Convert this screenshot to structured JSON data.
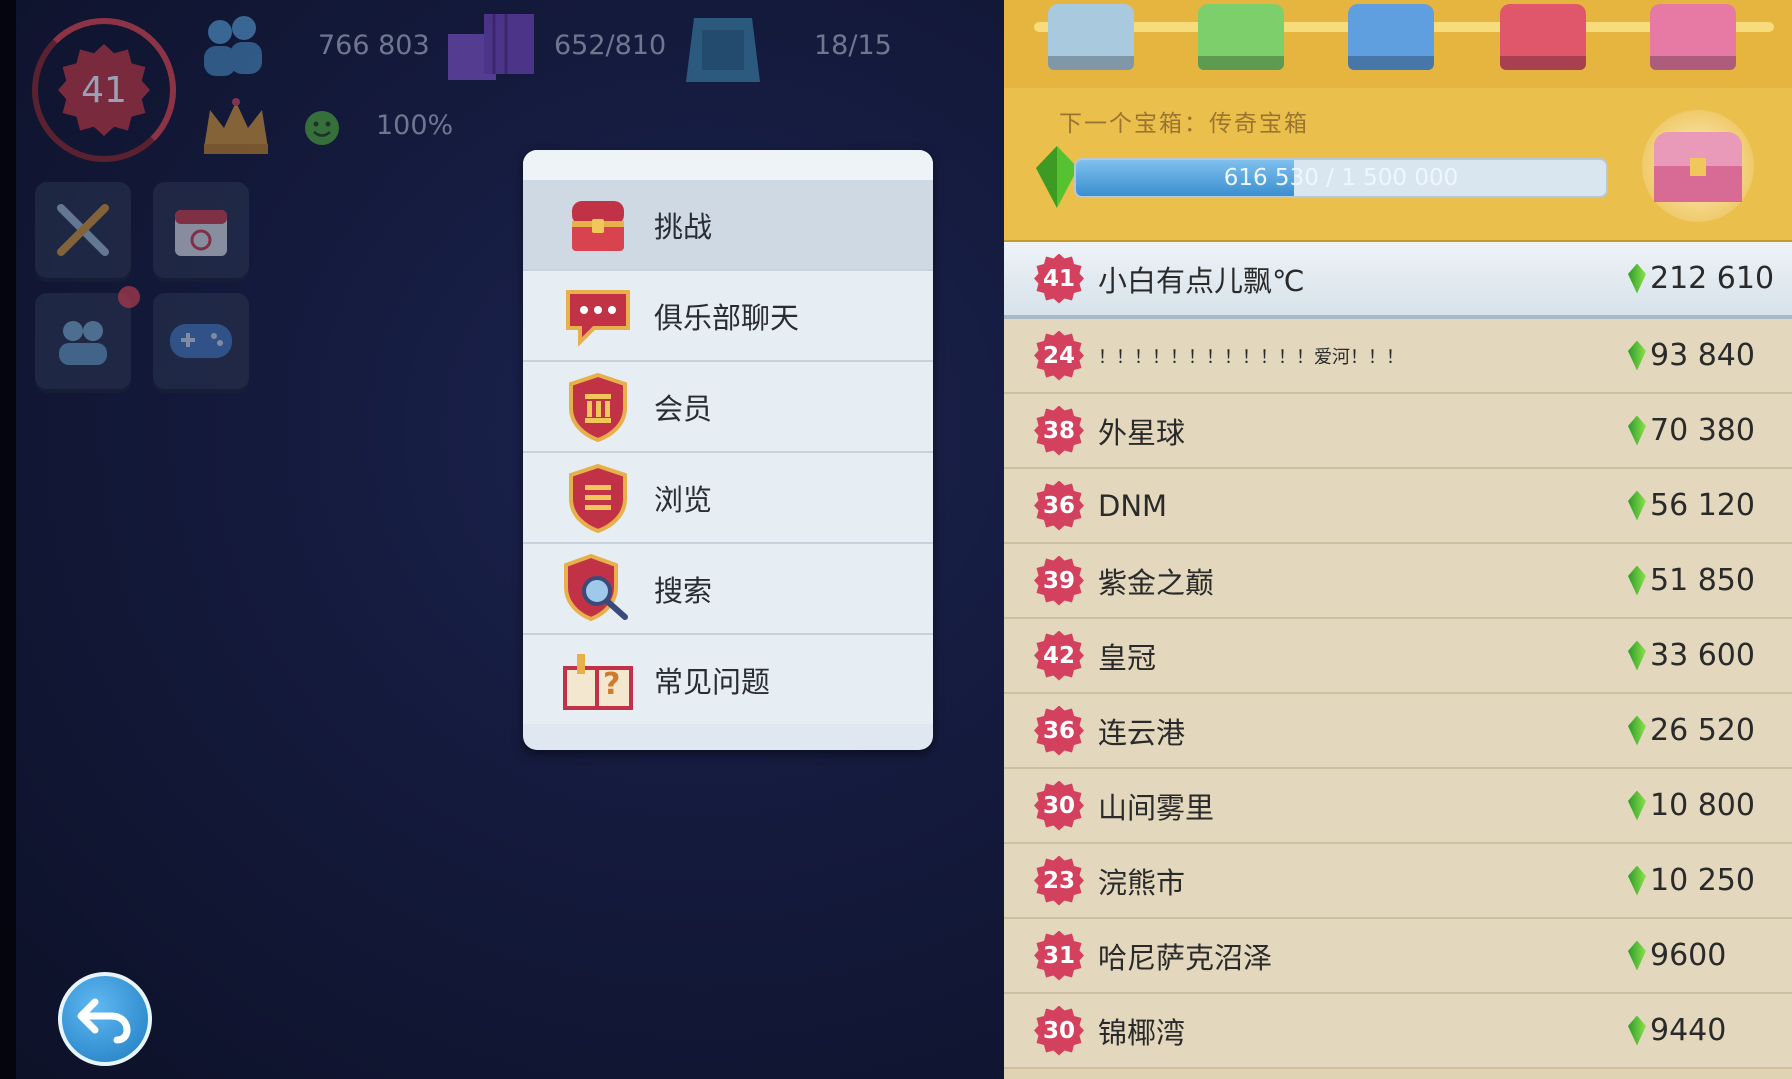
{
  "hud": {
    "level": "41",
    "population": "766 803",
    "storage": "652/810",
    "buildings": "18/15",
    "happiness": "100%"
  },
  "menu": {
    "items": [
      {
        "label": "挑战",
        "icon": "treasure-chest-icon"
      },
      {
        "label": "俱乐部聊天",
        "icon": "chat-bubble-icon"
      },
      {
        "label": "会员",
        "icon": "shield-bank-icon"
      },
      {
        "label": "浏览",
        "icon": "shield-list-icon"
      },
      {
        "label": "搜索",
        "icon": "magnifier-shield-icon"
      },
      {
        "label": "常见问题",
        "icon": "question-book-icon"
      }
    ]
  },
  "leaderboard": {
    "next_chest_label": "下一个宝箱：传奇宝箱",
    "progress_text": "616 530 / 1 500 000",
    "progress_fraction": 0.411,
    "rows": [
      {
        "level": "41",
        "name": "小白有点儿飘℃",
        "score": "212 610"
      },
      {
        "level": "24",
        "name": "！！！！！！！！！！！！爱河！！！",
        "score": "93 840"
      },
      {
        "level": "38",
        "name": "外星球",
        "score": "70 380"
      },
      {
        "level": "36",
        "name": "DNM",
        "score": "56 120"
      },
      {
        "level": "39",
        "name": "紫金之巅",
        "score": "51 850"
      },
      {
        "level": "42",
        "name": "皇冠",
        "score": "33 600"
      },
      {
        "level": "36",
        "name": "连云港",
        "score": "26 520"
      },
      {
        "level": "30",
        "name": "山间雾里",
        "score": "10 800"
      },
      {
        "level": "23",
        "name": "浣熊市",
        "score": "10 250"
      },
      {
        "level": "31",
        "name": "哈尼萨克沼泽",
        "score": "9600"
      },
      {
        "level": "30",
        "name": "锦椰湾",
        "score": "9440"
      }
    ]
  },
  "colors": {
    "chest_bar": "#e6b53f",
    "level_badge": "#d4415e",
    "gem": "#5cc33a",
    "progress_fill": "#3a8fd0"
  }
}
